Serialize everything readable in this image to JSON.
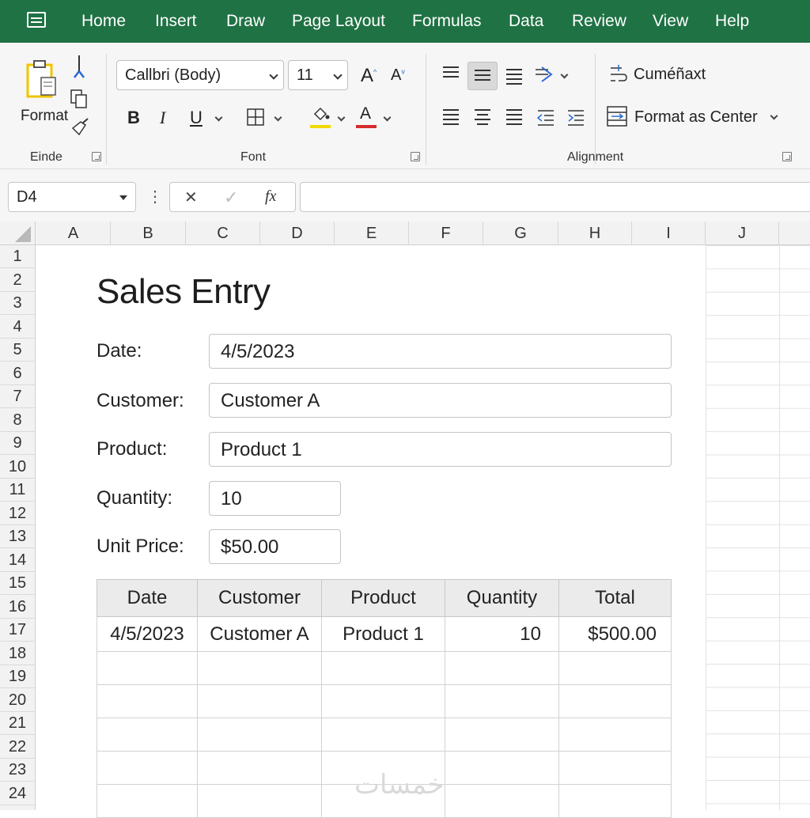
{
  "menu": {
    "tabs": [
      "Home",
      "Insert",
      "Draw",
      "Page Layout",
      "Formulas",
      "Data",
      "Review",
      "View",
      "Help"
    ]
  },
  "ribbon": {
    "clipboard": {
      "format_label": "Format",
      "group_label": "Einde"
    },
    "font": {
      "font_name": "Callbri (Body)",
      "font_size": "11",
      "grow_label": "A",
      "shrink_label": "A",
      "bold": "B",
      "italic": "I",
      "underline": "U",
      "font_color_label": "A",
      "group_label": "Font",
      "highlight_color": "#f5d800",
      "font_color": "#d72b2b"
    },
    "alignment": {
      "wrap_label": "Cuméñaxt",
      "merge_label": "Format as Center",
      "group_label": "Alignment"
    }
  },
  "formula_bar": {
    "name_box": "D4",
    "cancel_icon": "✕",
    "enter_icon": "✓",
    "fx_label": "fx",
    "value": ""
  },
  "grid": {
    "columns": [
      "A",
      "B",
      "C",
      "D",
      "E",
      "F",
      "G",
      "H",
      "I",
      "J"
    ],
    "rows": [
      "1",
      "2",
      "3",
      "4",
      "5",
      "6",
      "7",
      "8",
      "9",
      "10",
      "11",
      "12",
      "13",
      "14",
      "15",
      "16",
      "17",
      "18",
      "19",
      "20",
      "21",
      "22",
      "23",
      "24"
    ]
  },
  "form": {
    "title": "Sales Entry",
    "date_label": "Date:",
    "date_value": "4/5/2023",
    "customer_label": "Customer:",
    "customer_value": "Customer A",
    "product_label": "Product:",
    "product_value": "Product 1",
    "quantity_label": "Quantity:",
    "quantity_value": "10",
    "price_label": "Unit Price:",
    "price_value": "$50.00"
  },
  "table": {
    "headers": [
      "Date",
      "Customer",
      "Product",
      "Quantity",
      "Total"
    ],
    "rows": [
      [
        "4/5/2023",
        "Customer A",
        "Product 1",
        "10",
        "$500.00"
      ]
    ],
    "empty_rows": 5
  },
  "watermark": "خمسات",
  "colors": {
    "accent": "#1f7244",
    "ribbon_bg": "#f6f6f6"
  }
}
